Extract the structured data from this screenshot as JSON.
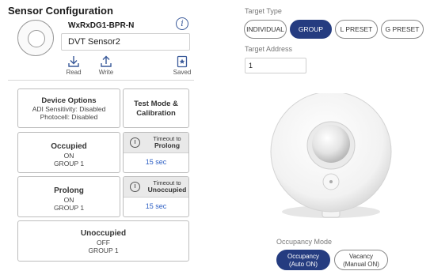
{
  "left": {
    "title": "Sensor Configuration",
    "model": "WxRxDG1-BPR-N",
    "sensor_name": "DVT Sensor2",
    "toolbar": {
      "read_label": "Read",
      "write_label": "Write",
      "saved_label": "Saved"
    },
    "device_options": {
      "header": "Device Options",
      "line1": "ADI Sensitivity: Disabled",
      "line2": "Photocell: Disabled"
    },
    "test_mode": {
      "line1": "Test Mode &",
      "line2": "Calibration"
    },
    "occupied": {
      "header": "Occupied",
      "state": "ON",
      "group": "GROUP 1"
    },
    "timeout_prolong": {
      "line1": "Timeout to",
      "line2": "Prolong",
      "value": "15 sec"
    },
    "prolong": {
      "header": "Prolong",
      "state": "ON",
      "group": "GROUP 1"
    },
    "timeout_unoccupied": {
      "line1": "Timeout to",
      "line2": "Unoccupied",
      "value": "15 sec"
    },
    "unoccupied": {
      "header": "Unoccupied",
      "state": "OFF",
      "group": "GROUP 1"
    }
  },
  "right": {
    "target_type_label": "Target Type",
    "target_types": [
      "INDIVIDUAL",
      "GROUP",
      "L PRESET",
      "G PRESET"
    ],
    "target_type_selected": "GROUP",
    "target_address_label": "Target Address",
    "target_address_value": "1",
    "occupancy_mode_label": "Occupancy Mode",
    "occupancy_modes": [
      {
        "line1": "Occupancy",
        "line2": "(Auto ON)"
      },
      {
        "line1": "Vacancy",
        "line2": "(Manual ON)"
      }
    ],
    "occupancy_mode_selected": "Occupancy"
  },
  "colors": {
    "accent": "#253c80",
    "link_blue": "#2d5fc4",
    "card_border": "#bdbdbd"
  }
}
